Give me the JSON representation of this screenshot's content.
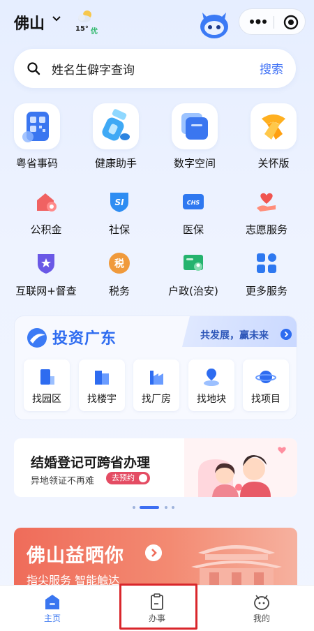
{
  "header": {
    "city": "佛山",
    "temperature": "15°",
    "aqi": "优"
  },
  "search": {
    "placeholder": "姓名生僻字查询",
    "button": "搜索"
  },
  "main_services": [
    {
      "label": "粤省事码",
      "icon": "qr-code-icon"
    },
    {
      "label": "健康助手",
      "icon": "cup-icon"
    },
    {
      "label": "数字空间",
      "icon": "folder-icon"
    },
    {
      "label": "关怀版",
      "icon": "scarf-icon"
    }
  ],
  "services": [
    {
      "label": "公积金",
      "icon": "house-fund-icon"
    },
    {
      "label": "社保",
      "icon": "social-security-icon"
    },
    {
      "label": "医保",
      "icon": "medical-insurance-icon"
    },
    {
      "label": "志愿服务",
      "icon": "volunteer-heart-icon"
    },
    {
      "label": "互联网+督查",
      "icon": "shield-star-icon"
    },
    {
      "label": "税务",
      "icon": "tax-icon"
    },
    {
      "label": "户政(治安)",
      "icon": "id-card-icon"
    },
    {
      "label": "更多服务",
      "icon": "grid-icon"
    }
  ],
  "icon_text": {
    "social_security": "SI",
    "medical_insurance": "CHS",
    "tax": "税"
  },
  "invest": {
    "title": "投资广东",
    "slogan": "共发展，赢未来",
    "items": [
      "找园区",
      "找楼宇",
      "找厂房",
      "找地块",
      "找项目"
    ]
  },
  "marriage_banner": {
    "title": "结婚登记可跨省办理",
    "subtitle": "异地领证不再难",
    "button": "去预约"
  },
  "carousel": {
    "count": 4,
    "active_index": 1
  },
  "foshan_banner": {
    "title": "佛山益晒你",
    "subtitle": "指尖服务 智能触达"
  },
  "tabbar": {
    "items": [
      {
        "label": "主页",
        "active": true,
        "icon": "home-icon"
      },
      {
        "label": "办事",
        "active": false,
        "icon": "clipboard-icon"
      },
      {
        "label": "我的",
        "active": false,
        "icon": "profile-mascot-icon"
      }
    ]
  },
  "colors": {
    "accent": "#3b6ef5",
    "highlight_box": "#d9262b",
    "foshan_banner": "#ef6c5a",
    "marriage_button": "#e44c63"
  }
}
